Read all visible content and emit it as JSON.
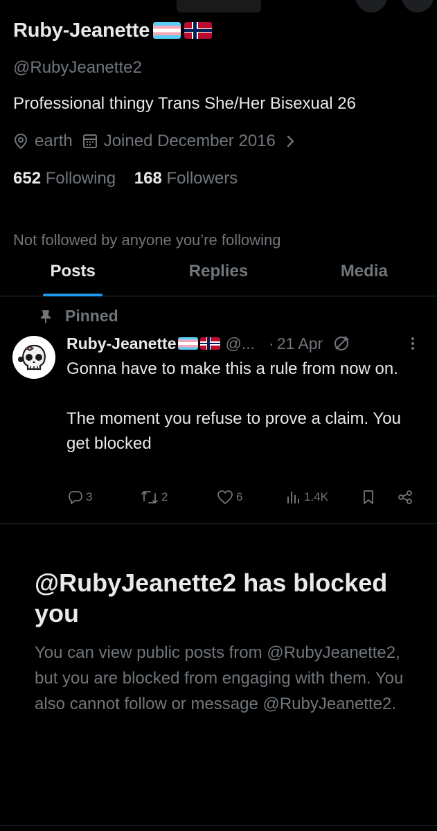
{
  "profile": {
    "display_name": "Ruby-Jeanette",
    "flags": [
      "transgender-flag",
      "norway-flag"
    ],
    "handle": "@RubyJeanette2",
    "bio": "Professional thingy Trans She/Her Bisexual 26",
    "location": "earth",
    "joined": "Joined December 2016",
    "following_count": "652",
    "following_label": "Following",
    "followers_count": "168",
    "followers_label": "Followers",
    "not_followed_notice": "Not followed by anyone you’re following"
  },
  "tabs": [
    {
      "label": "Posts",
      "active": true
    },
    {
      "label": "Replies",
      "active": false
    },
    {
      "label": "Media",
      "active": false
    }
  ],
  "pinned_post": {
    "pinned_label": "Pinned",
    "author_name": "Ruby-Jeanette",
    "author_handle": "@...",
    "separator": "·",
    "date": "21 Apr",
    "text_line1": "Gonna have to make this a rule from now on.",
    "text_line2": "The moment you refuse to prove a claim. You get blocked",
    "replies": "3",
    "reposts": "2",
    "likes": "6",
    "views": "1.4K"
  },
  "blocked_notice": {
    "title": "@RubyJeanette2 has blocked you",
    "body": "You can view public posts from @RubyJeanette2, but you are blocked from engaging with them. You also cannot follow or message @RubyJeanette2."
  },
  "colors": {
    "background": "#000000",
    "text_primary": "#e7e9ea",
    "text_secondary": "#71767b",
    "accent": "#1d9bf0",
    "divider": "#2f3336"
  }
}
